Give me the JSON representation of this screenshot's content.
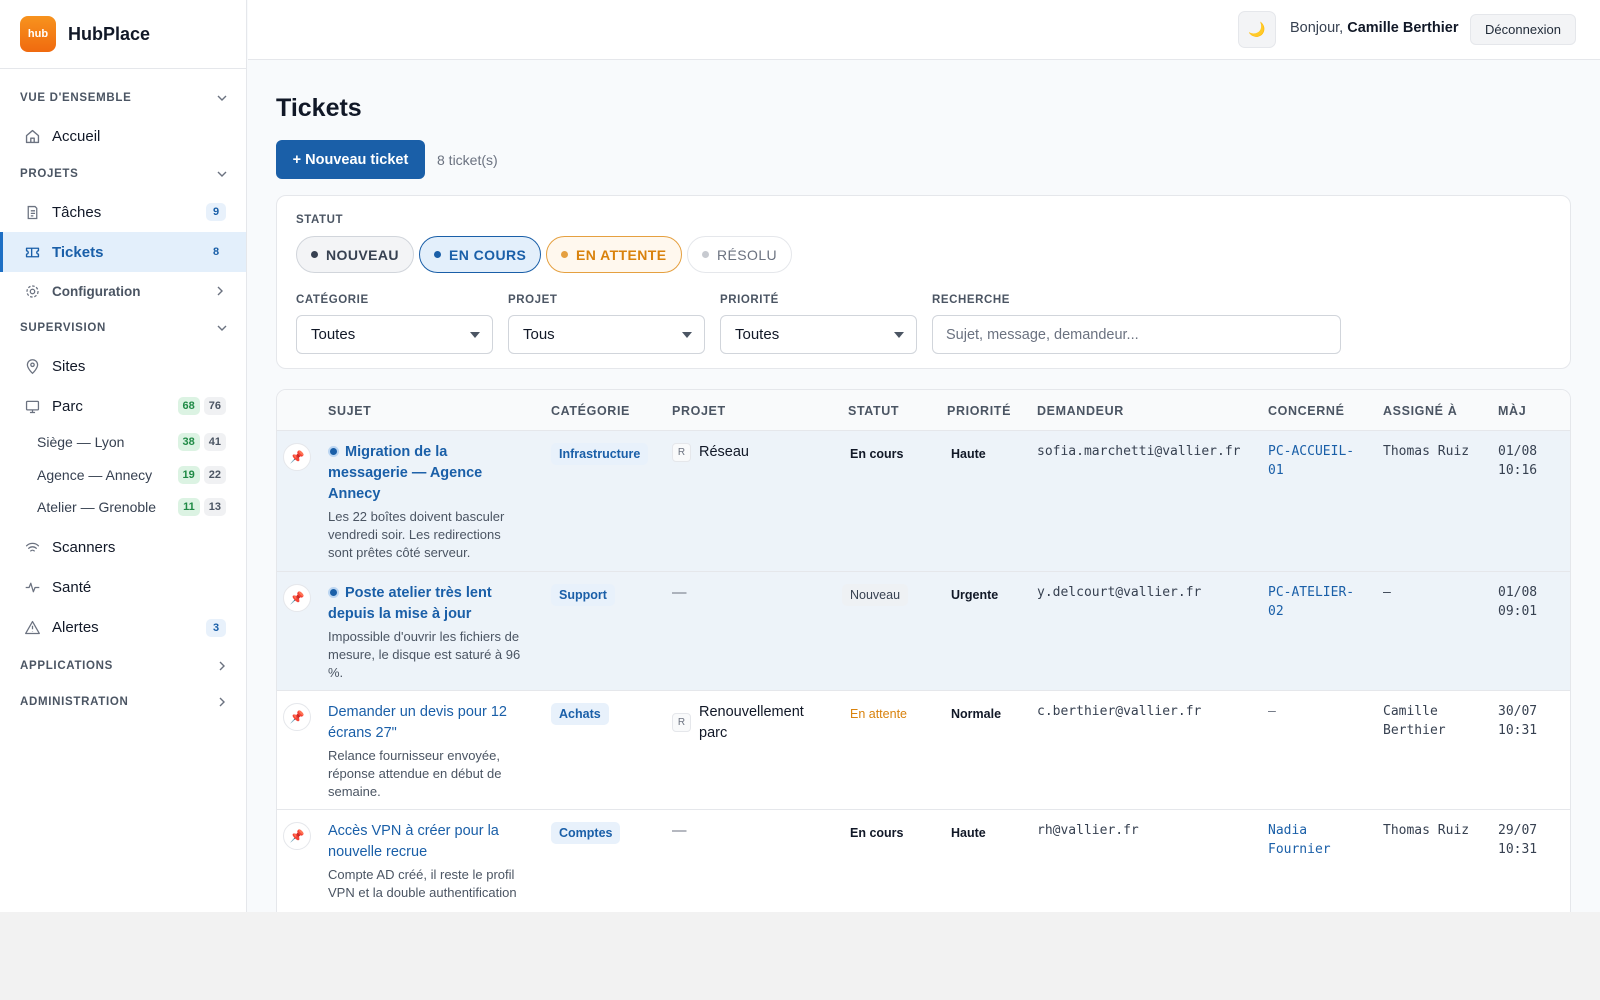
{
  "brand": {
    "logo_text": "hub",
    "name": "HubPlace"
  },
  "sidebar": {
    "sections": [
      {
        "label": "VUE D'ENSEMBLE"
      },
      {
        "label": "PROJETS"
      },
      {
        "label": "SUPERVISION"
      },
      {
        "label": "APPLICATIONS"
      },
      {
        "label": "ADMINISTRATION"
      }
    ],
    "items": {
      "accueil": {
        "label": "Accueil",
        "icon": "home-icon"
      },
      "taches": {
        "label": "Tâches",
        "badge": "9",
        "icon": "task-icon"
      },
      "tickets": {
        "label": "Tickets",
        "badge": "8",
        "icon": "ticket-icon"
      },
      "configuration": {
        "label": "Configuration",
        "icon": "gear-icon"
      },
      "sites": {
        "label": "Sites",
        "icon": "map-pin-icon"
      },
      "parc": {
        "label": "Parc",
        "badge_green": "68",
        "badge_gray": "76",
        "icon": "monitor-icon"
      },
      "scanners": {
        "label": "Scanners",
        "icon": "wifi-icon"
      },
      "sante": {
        "label": "Santé",
        "icon": "pulse-icon"
      },
      "alertes": {
        "label": "Alertes",
        "badge": "3",
        "icon": "warning-icon"
      }
    },
    "parc_sites": [
      {
        "label": "Siège — Lyon",
        "green": "38",
        "gray": "41"
      },
      {
        "label": "Agence — Annecy",
        "green": "19",
        "gray": "22"
      },
      {
        "label": "Atelier — Grenoble",
        "green": "11",
        "gray": "13"
      }
    ]
  },
  "header": {
    "theme_icon": "🌙",
    "greeting": "Bonjour,",
    "user_name": "Camille Berthier",
    "logout_label": "Déconnexion"
  },
  "main": {
    "title": "Tickets",
    "new_button": "+ Nouveau ticket",
    "count": "8 ticket(s)"
  },
  "filters": {
    "status_label": "STATUT",
    "statuses": [
      {
        "label": "NOUVEAU"
      },
      {
        "label": "EN COURS"
      },
      {
        "label": "EN ATTENTE"
      },
      {
        "label": "RÉSOLU"
      }
    ],
    "category": {
      "label": "CATÉGORIE",
      "value": "Toutes"
    },
    "project": {
      "label": "PROJET",
      "value": "Tous"
    },
    "priority": {
      "label": "PRIORITÉ",
      "value": "Toutes"
    },
    "search": {
      "label": "RECHERCHE",
      "placeholder": "Sujet, message, demandeur..."
    }
  },
  "table": {
    "columns": [
      "SUJET",
      "CATÉGORIE",
      "PROJET",
      "STATUT",
      "PRIORITÉ",
      "DEMANDEUR",
      "CONCERNÉ",
      "ASSIGNÉ À",
      "MÀJ"
    ],
    "rows": [
      {
        "title": "Migration de la messagerie — Agence Annecy",
        "message": "Les 22 boîtes doivent basculer vendredi soir. Les redirections sont prêtes côté serveur.",
        "category": "Infrastructure",
        "project_tag": "R",
        "project": "Réseau",
        "status": "En cours",
        "priority": "Haute",
        "requester": "sofia.marchetti@vallier.fr",
        "concerned": "PC-ACCUEIL-01",
        "assignee": "Thomas Ruiz",
        "updated_date": "01/08",
        "updated_time": "10:16"
      },
      {
        "title": "Poste atelier très lent depuis la mise à jour",
        "message": "Impossible d'ouvrir les fichiers de mesure, le disque est saturé à 96 %.",
        "category": "Support",
        "project": "—",
        "status": "Nouveau",
        "priority": "Urgente",
        "requester": "y.delcourt@vallier.fr",
        "concerned": "PC-ATELIER-02",
        "assignee": "—",
        "updated_date": "01/08",
        "updated_time": "09:01"
      },
      {
        "title": "Demander un devis pour 12 écrans 27\"",
        "message": "Relance fournisseur envoyée, réponse attendue en début de semaine.",
        "category": "Achats",
        "project_tag": "R",
        "project": "Renouvellement parc",
        "status": "En attente",
        "priority": "Normale",
        "requester": "c.berthier@vallier.fr",
        "concerned": "—",
        "assignee": "Camille Berthier",
        "updated_date": "30/07",
        "updated_time": "10:31"
      },
      {
        "title": "Accès VPN à créer pour la nouvelle recrue",
        "message": "Compte AD créé, il reste le profil VPN et la double authentification",
        "category": "Comptes",
        "project": "—",
        "status": "En cours",
        "priority": "Haute",
        "requester": "rh@vallier.fr",
        "concerned": "Nadia Fournier",
        "assignee": "Thomas Ruiz",
        "updated_date": "29/07",
        "updated_time": "10:31"
      }
    ]
  },
  "colors": {
    "accent": "#1a5fa8",
    "active_bg": "#e3effb",
    "brand_orange": "#f28a1a",
    "status_en_attente": "#d9820c"
  }
}
